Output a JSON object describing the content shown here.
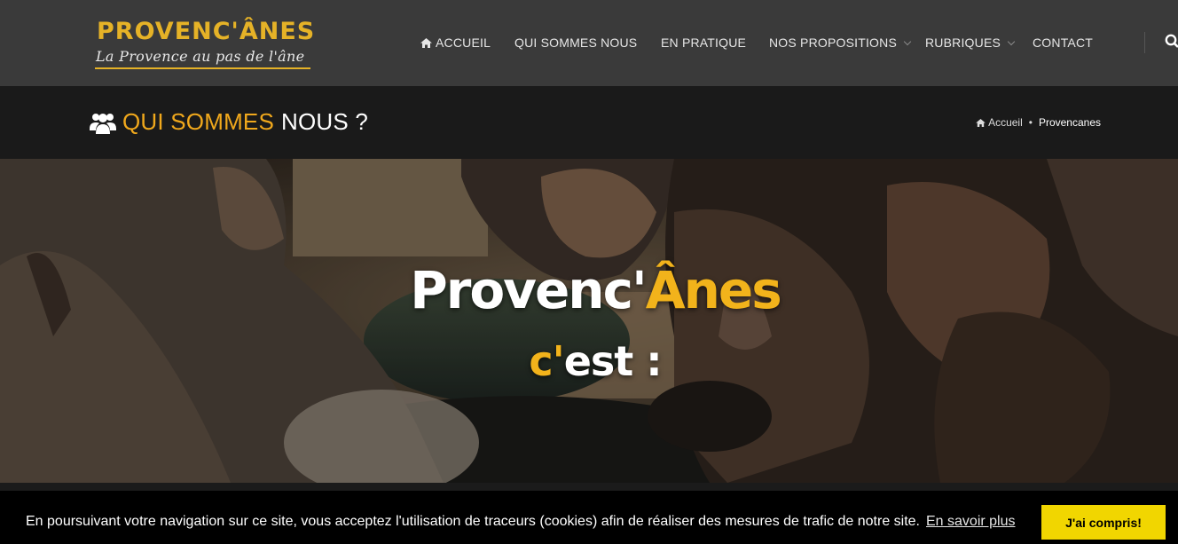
{
  "header": {
    "logo_title": "PROVENC'ÂNES",
    "logo_tagline": "La Provence au pas de l'âne",
    "nav": [
      {
        "label": "ACCUEIL",
        "icon": "home-icon"
      },
      {
        "label": "QUI SOMMES NOUS"
      },
      {
        "label": "EN PRATIQUE"
      },
      {
        "label": "NOS PROPOSITIONS",
        "has_dropdown": true
      },
      {
        "label": "RUBRIQUES",
        "has_dropdown": true
      },
      {
        "label": "CONTACT"
      }
    ],
    "search_icon": "search-icon"
  },
  "title_bar": {
    "icon": "users-icon",
    "title_accent": "QUI SOMMES",
    "title_rest": "NOUS ?",
    "breadcrumb": {
      "home_label": "Accueil",
      "separator": "•",
      "current": "Provencanes"
    }
  },
  "hero": {
    "title_white": "Provenc'",
    "title_yellow": "Ânes",
    "sub_yellow": "c'",
    "sub_white": "est :"
  },
  "cookie_banner": {
    "text": "En poursuivant votre navigation sur ce site, vous acceptez l'utilisation de traceurs (cookies) afin de réaliser des mesures de trafic de notre site.",
    "link_label": "En savoir plus",
    "button_label": "J'ai compris!"
  },
  "colors": {
    "accent": "#f0a81c",
    "logo_gold": "#e5b227",
    "header_bg": "#3a3a3a",
    "title_bar_bg": "#1a1a1a",
    "cookie_button": "#f1d600"
  }
}
